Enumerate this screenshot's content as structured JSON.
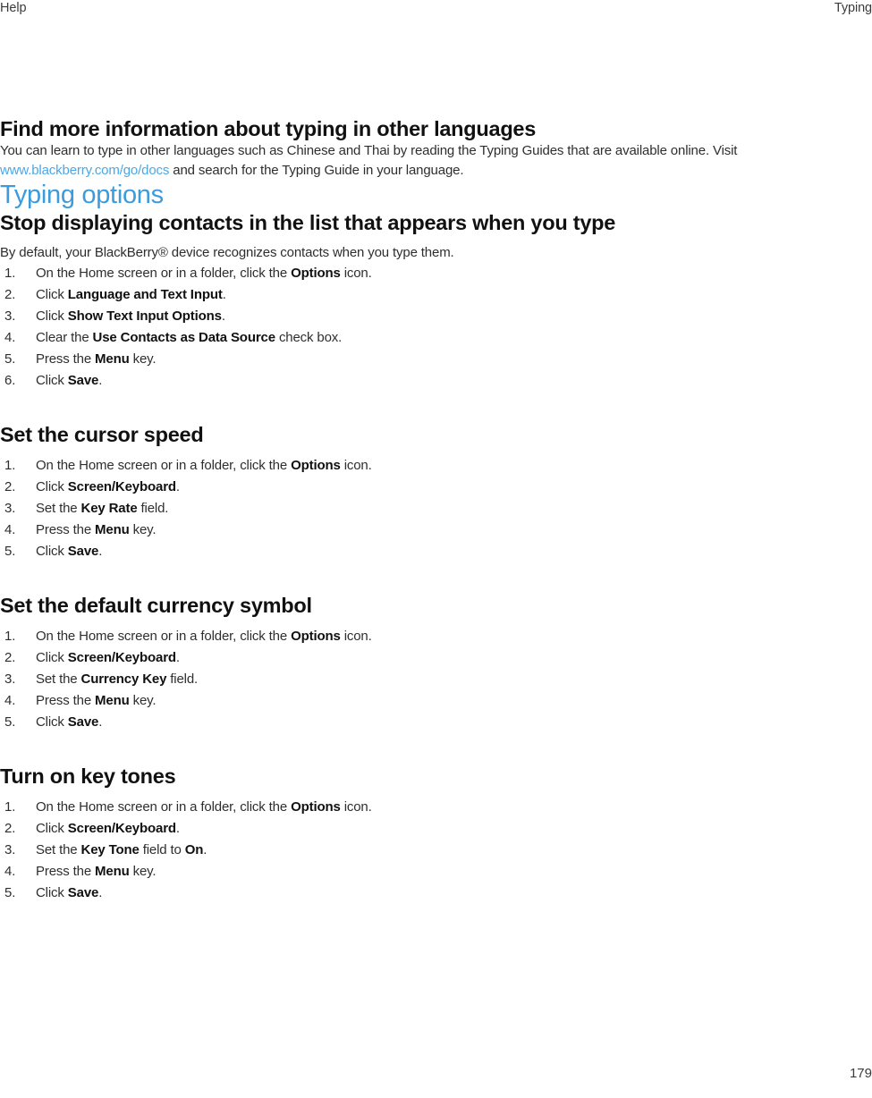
{
  "header": {
    "left": "Help",
    "right": "Typing"
  },
  "intro_topic": {
    "heading": "Find more information about typing in other languages",
    "paragraph_before_link": "You can learn to type in other languages such as Chinese and Thai by reading the Typing Guides that are available online. Visit ",
    "link_text": "www.blackberry.com/go/docs",
    "paragraph_after_link": " and search for the Typing Guide in your language."
  },
  "section": {
    "title": "Typing options"
  },
  "topics": [
    {
      "heading": "Stop displaying contacts in the list that appears when you type",
      "intro": "By default, your BlackBerry® device recognizes contacts when you type them.",
      "steps": [
        [
          {
            "t": "On the Home screen or in a folder, click the "
          },
          {
            "t": "Options",
            "b": true
          },
          {
            "t": " icon."
          }
        ],
        [
          {
            "t": "Click "
          },
          {
            "t": "Language and Text Input",
            "b": true
          },
          {
            "t": "."
          }
        ],
        [
          {
            "t": "Click "
          },
          {
            "t": "Show Text Input Options",
            "b": true
          },
          {
            "t": "."
          }
        ],
        [
          {
            "t": "Clear the "
          },
          {
            "t": "Use Contacts as Data Source",
            "b": true
          },
          {
            "t": " check box."
          }
        ],
        [
          {
            "t": "Press the "
          },
          {
            "t": "Menu",
            "b": true
          },
          {
            "t": " key."
          }
        ],
        [
          {
            "t": "Click "
          },
          {
            "t": "Save",
            "b": true
          },
          {
            "t": "."
          }
        ]
      ]
    },
    {
      "heading": "Set the cursor speed",
      "intro": null,
      "steps": [
        [
          {
            "t": "On the Home screen or in a folder, click the "
          },
          {
            "t": "Options",
            "b": true
          },
          {
            "t": " icon."
          }
        ],
        [
          {
            "t": "Click "
          },
          {
            "t": "Screen/Keyboard",
            "b": true
          },
          {
            "t": "."
          }
        ],
        [
          {
            "t": "Set the "
          },
          {
            "t": "Key Rate",
            "b": true
          },
          {
            "t": " field."
          }
        ],
        [
          {
            "t": "Press the "
          },
          {
            "t": "Menu",
            "b": true
          },
          {
            "t": " key."
          }
        ],
        [
          {
            "t": "Click "
          },
          {
            "t": "Save",
            "b": true
          },
          {
            "t": "."
          }
        ]
      ]
    },
    {
      "heading": "Set the default currency symbol",
      "intro": null,
      "steps": [
        [
          {
            "t": "On the Home screen or in a folder, click the "
          },
          {
            "t": "Options",
            "b": true
          },
          {
            "t": " icon."
          }
        ],
        [
          {
            "t": "Click "
          },
          {
            "t": "Screen/Keyboard",
            "b": true
          },
          {
            "t": "."
          }
        ],
        [
          {
            "t": "Set the "
          },
          {
            "t": "Currency Key",
            "b": true
          },
          {
            "t": " field."
          }
        ],
        [
          {
            "t": "Press the "
          },
          {
            "t": "Menu",
            "b": true
          },
          {
            "t": " key."
          }
        ],
        [
          {
            "t": "Click "
          },
          {
            "t": "Save",
            "b": true
          },
          {
            "t": "."
          }
        ]
      ]
    },
    {
      "heading": "Turn on key tones",
      "intro": null,
      "steps": [
        [
          {
            "t": "On the Home screen or in a folder, click the "
          },
          {
            "t": "Options",
            "b": true
          },
          {
            "t": " icon."
          }
        ],
        [
          {
            "t": "Click "
          },
          {
            "t": "Screen/Keyboard",
            "b": true
          },
          {
            "t": "."
          }
        ],
        [
          {
            "t": "Set the "
          },
          {
            "t": "Key Tone",
            "b": true
          },
          {
            "t": " field to "
          },
          {
            "t": "On",
            "b": true
          },
          {
            "t": "."
          }
        ],
        [
          {
            "t": "Press the "
          },
          {
            "t": "Menu",
            "b": true
          },
          {
            "t": " key."
          }
        ],
        [
          {
            "t": "Click "
          },
          {
            "t": "Save",
            "b": true
          },
          {
            "t": "."
          }
        ]
      ]
    }
  ],
  "footer": {
    "page_number": "179"
  },
  "colors": {
    "section_heading": "#3b9bdc",
    "link": "#4aa8e8",
    "body_text": "#2e2e2e",
    "heading_text": "#111111",
    "background": "#ffffff"
  }
}
